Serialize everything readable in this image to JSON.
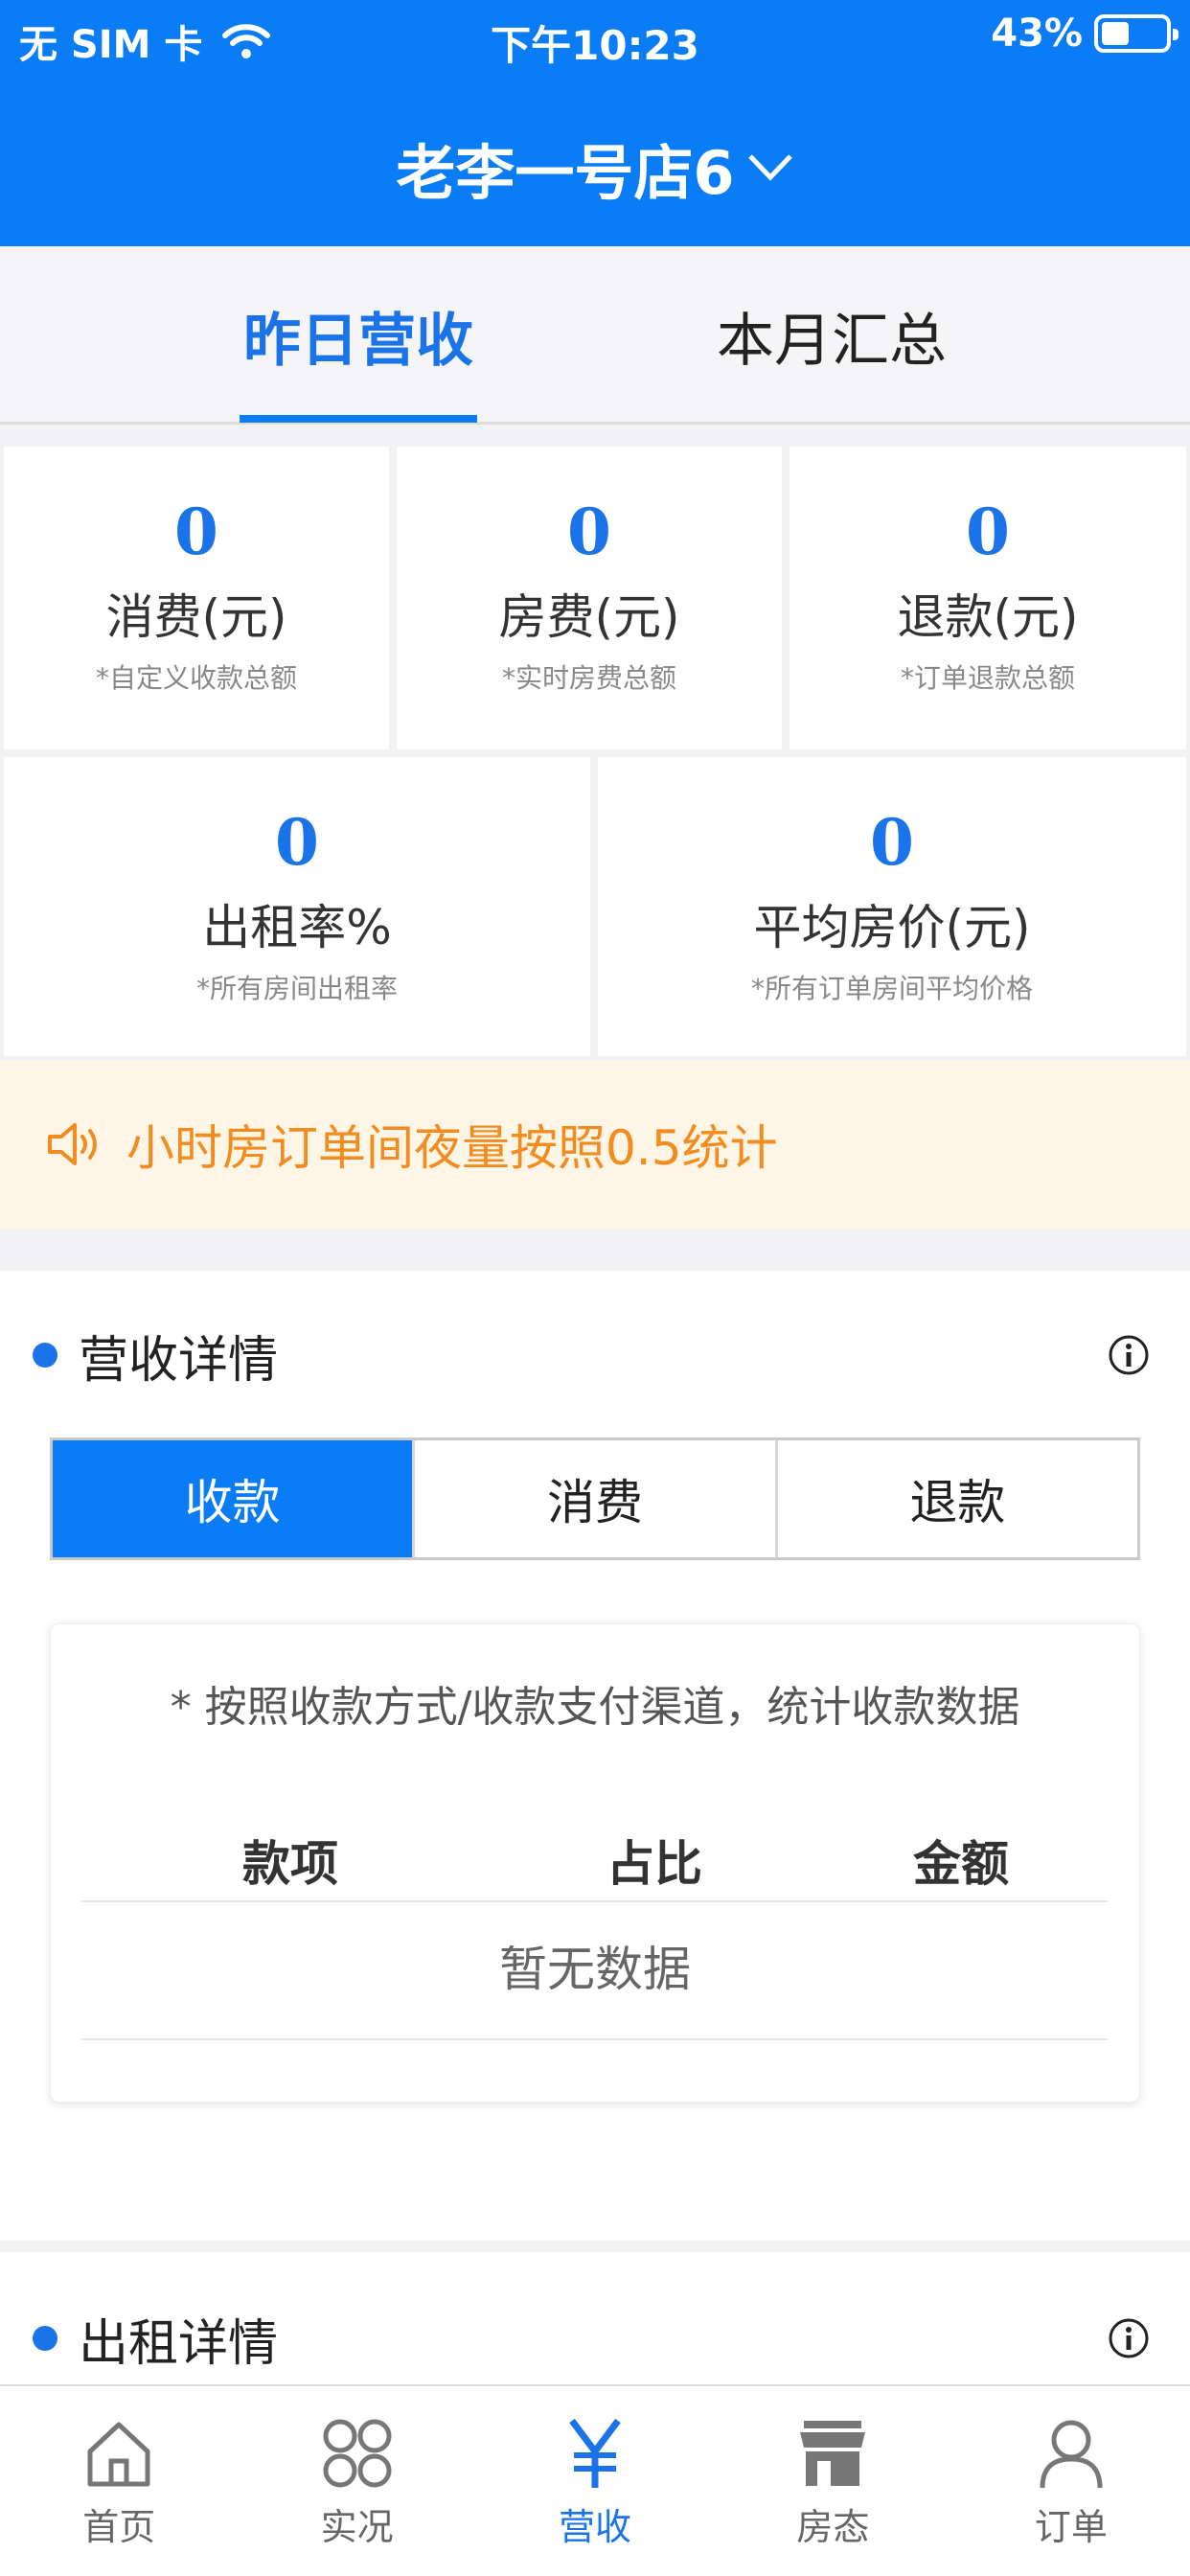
{
  "status_bar": {
    "carrier": "无 SIM 卡",
    "time": "下午10:23",
    "battery": "43%",
    "battery_level": 0.43
  },
  "header": {
    "store_name": "老李一号店6"
  },
  "tabs": [
    {
      "label": "昨日营收",
      "active": true
    },
    {
      "label": "本月汇总",
      "active": false
    }
  ],
  "stats_row1": [
    {
      "value": "0",
      "label": "消费(元)",
      "sub": "*自定义收款总额"
    },
    {
      "value": "0",
      "label": "房费(元)",
      "sub": "*实时房费总额"
    },
    {
      "value": "0",
      "label": "退款(元)",
      "sub": "*订单退款总额"
    }
  ],
  "stats_row2": [
    {
      "value": "0",
      "label": "出租率%",
      "sub": "*所有房间出租率"
    },
    {
      "value": "0",
      "label": "平均房价(元)",
      "sub": "*所有订单房间平均价格"
    }
  ],
  "notice": {
    "text": "小时房订单间夜量按照0.5统计"
  },
  "revenue": {
    "title": "营收详情",
    "segments": [
      "收款",
      "消费",
      "退款"
    ],
    "note": "* 按照收款方式/收款支付渠道，统计收款数据",
    "columns": [
      "款项",
      "占比",
      "金额"
    ],
    "empty": "暂无数据"
  },
  "rental": {
    "title": "出租详情"
  },
  "nav": [
    {
      "label": "首页",
      "icon": "home-icon"
    },
    {
      "label": "实况",
      "icon": "grid-icon"
    },
    {
      "label": "营收",
      "icon": "yen-icon",
      "active": true
    },
    {
      "label": "房态",
      "icon": "store-icon"
    },
    {
      "label": "订单",
      "icon": "user-icon"
    }
  ],
  "colors": {
    "primary": "#0a7cf5",
    "notice_text": "#f48b1f",
    "notice_bg": "#fdf6e7"
  }
}
